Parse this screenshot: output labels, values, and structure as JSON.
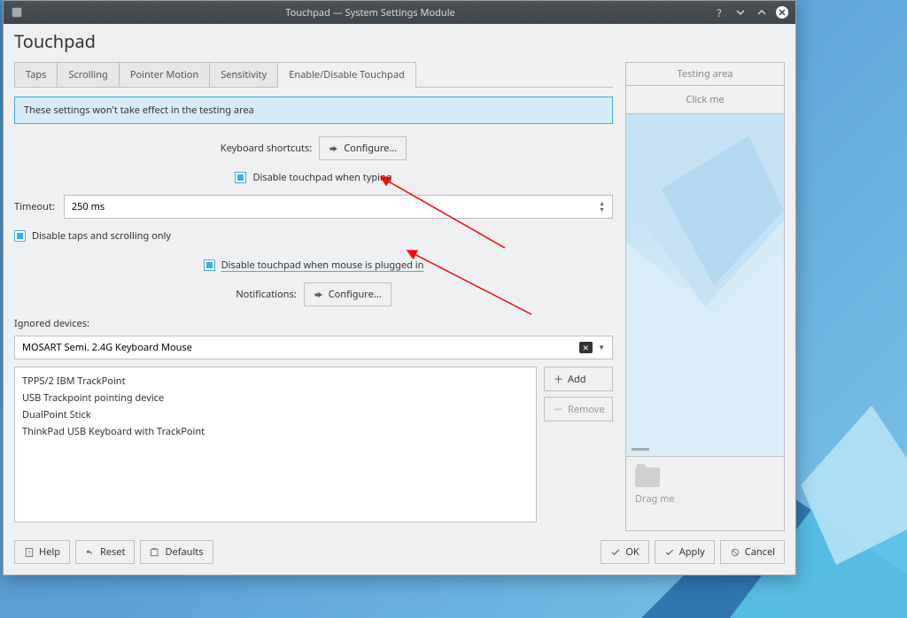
{
  "window": {
    "title": "Touchpad — System Settings Module"
  },
  "page": {
    "title": "Touchpad"
  },
  "tabs": {
    "items": [
      {
        "label": "Taps"
      },
      {
        "label": "Scrolling"
      },
      {
        "label": "Pointer Motion"
      },
      {
        "label": "Sensitivity"
      },
      {
        "label": "Enable/Disable Touchpad"
      }
    ]
  },
  "info": "These settings won't take effect in the testing area",
  "labels": {
    "kbShortcuts": "Keyboard shortcuts:",
    "configure": "Configure...",
    "disableTyping": "Disable touchpad when typing",
    "timeout": "Timeout:",
    "timeoutValue": "250 ms",
    "disableTaps": "Disable taps and scrolling only",
    "disableMouse": "Disable touchpad when mouse is plugged in",
    "notifications": "Notifications:",
    "ignored": "Ignored devices:",
    "add": "Add",
    "remove": "Remove"
  },
  "combo": {
    "selected": "MOSART Semi. 2.4G Keyboard Mouse"
  },
  "devices": [
    "TPPS/2 IBM TrackPoint",
    "USB Trackpoint pointing device",
    "DualPoint Stick",
    "ThinkPad USB Keyboard with TrackPoint"
  ],
  "testing": {
    "header": "Testing area",
    "click": "Click me",
    "drag": "Drag me"
  },
  "footer": {
    "help": "Help",
    "reset": "Reset",
    "defaults": "Defaults",
    "ok": "OK",
    "apply": "Apply",
    "cancel": "Cancel"
  }
}
